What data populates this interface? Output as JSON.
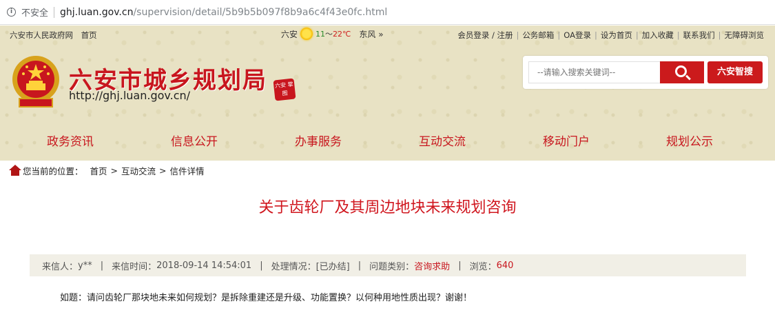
{
  "browser": {
    "info_icon": "i",
    "security_label": "不安全",
    "url_host": "ghj.luan.gov.cn",
    "url_path": "/supervision/detail/5b9b5b097f8b9a6c4f43e0fc.html"
  },
  "topbar": {
    "gov_link": "六安市人民政府网",
    "home_link": "首页",
    "city": "六安",
    "temp_low": "11",
    "temp_sep": "～",
    "temp_high": "22℃",
    "wind": "东风 »",
    "links": [
      "会员登录 / 注册",
      "公务邮箱",
      "OA登录",
      "设为首页",
      "加入收藏",
      "联系我们",
      "无障碍浏览"
    ]
  },
  "header": {
    "title": "六安市城乡规划局",
    "url": "http://ghj.luan.gov.cn/",
    "seal_text": "六安 掌图"
  },
  "search": {
    "placeholder": "--请输入搜索关键词--",
    "smart_label": "六安智搜"
  },
  "nav": {
    "items": [
      "政务资讯",
      "信息公开",
      "办事服务",
      "互动交流",
      "移动门户",
      "规划公示"
    ]
  },
  "breadcrumb": {
    "label": "您当前的位置：",
    "items": [
      "首页",
      "互动交流",
      "信件详情"
    ],
    "arrow": ">"
  },
  "letter": {
    "title": "关于齿轮厂及其周边地块未来规划咨询",
    "sender_label": "来信人：",
    "sender": "y**",
    "time_label": "来信时间：",
    "time": "2018-09-14 14:54:01",
    "status_label": "处理情况：",
    "status": "[已办结]",
    "category_label": "问题类别：",
    "category": "咨询求助",
    "views_label": "浏览：",
    "views": "640",
    "pipe": "|",
    "question": "如题：请问齿轮厂那块地未来如何规划？是拆除重建还是升级、功能置换？以何种用地性质出现？谢谢！"
  },
  "colors": {
    "brand_red": "#c8161e",
    "header_bg": "#e8e2c4",
    "meta_bg": "#f1efe6"
  }
}
